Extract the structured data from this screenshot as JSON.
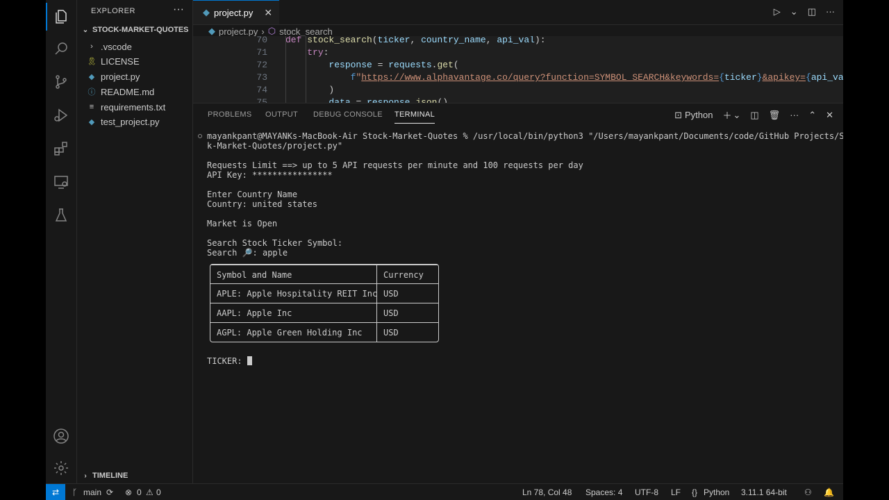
{
  "sidebar": {
    "title": "EXPLORER",
    "project": "STOCK-MARKET-QUOTES",
    "items": [
      {
        "label": ".vscode",
        "icon": "chevron-right-icon"
      },
      {
        "label": "LICENSE",
        "icon": "license-icon"
      },
      {
        "label": "project.py",
        "icon": "python-file-icon"
      },
      {
        "label": "README.md",
        "icon": "info-icon"
      },
      {
        "label": "requirements.txt",
        "icon": "text-file-icon"
      },
      {
        "label": "test_project.py",
        "icon": "python-file-icon"
      }
    ],
    "timeline": "TIMELINE"
  },
  "editor": {
    "tab": "project.py",
    "breadcrumb": {
      "file": "project.py",
      "symbol": "stock_search"
    },
    "lines": [
      {
        "num": "70",
        "parts": [
          [
            "kw",
            "def "
          ],
          [
            "fn",
            "stock_search"
          ],
          [
            "plain",
            "("
          ],
          [
            "var",
            "ticker"
          ],
          [
            "plain",
            ", "
          ],
          [
            "var",
            "country_name"
          ],
          [
            "plain",
            ", "
          ],
          [
            "var",
            "api_val"
          ],
          [
            "plain",
            "):"
          ]
        ]
      },
      {
        "num": "71",
        "parts": [
          [
            "plain",
            "    "
          ],
          [
            "kw",
            "try"
          ],
          [
            "plain",
            ":"
          ]
        ]
      },
      {
        "num": "72",
        "parts": [
          [
            "plain",
            "        "
          ],
          [
            "var",
            "response"
          ],
          [
            "plain",
            " = "
          ],
          [
            "var",
            "requests"
          ],
          [
            "plain",
            "."
          ],
          [
            "fn",
            "get"
          ],
          [
            "plain",
            "("
          ]
        ]
      },
      {
        "num": "73",
        "parts": [
          [
            "plain",
            "            "
          ],
          [
            "brace",
            "f"
          ],
          [
            "str",
            "\""
          ],
          [
            "url",
            "https://www.alphavantage.co/query?function=SYMBOL_SEARCH&keywords="
          ],
          [
            "brace",
            "{"
          ],
          [
            "var",
            "ticker"
          ],
          [
            "brace",
            "}"
          ],
          [
            "url",
            "&apikey="
          ],
          [
            "brace",
            "{"
          ],
          [
            "var",
            "api_val"
          ],
          [
            "brace",
            "}"
          ],
          [
            "str",
            "\""
          ]
        ]
      },
      {
        "num": "74",
        "parts": [
          [
            "plain",
            "        )"
          ]
        ]
      },
      {
        "num": "75",
        "parts": [
          [
            "plain",
            "        "
          ],
          [
            "var",
            "data"
          ],
          [
            "plain",
            " = "
          ],
          [
            "var",
            "response"
          ],
          [
            "plain",
            "."
          ],
          [
            "fn",
            "json"
          ],
          [
            "plain",
            "()"
          ]
        ]
      }
    ]
  },
  "panel": {
    "tabs": [
      "PROBLEMS",
      "OUTPUT",
      "DEBUG CONSOLE",
      "TERMINAL"
    ],
    "active_tab": "TERMINAL",
    "shell": "Python",
    "terminal_lines": [
      "mayankpant@MAYANKs-MacBook-Air Stock-Market-Quotes % /usr/local/bin/python3 \"/Users/mayankpant/Documents/code/GitHub Projects/Stoc",
      "k-Market-Quotes/project.py\"",
      "",
      "Requests Limit ==> up to 5 API requests per minute and 100 requests per day",
      "API Key: ****************",
      "",
      "Enter Country Name",
      "Country: united states",
      "",
      "Market is Open",
      "",
      "Search Stock Ticker Symbol:",
      "Search 🔎: apple"
    ],
    "table": {
      "headers": [
        "Symbol and Name",
        "Currency"
      ],
      "rows": [
        [
          "APLE: Apple Hospitality REIT Inc",
          "USD"
        ],
        [
          "AAPL: Apple Inc",
          "USD"
        ],
        [
          "AGPL: Apple Green Holding Inc",
          "USD"
        ]
      ]
    },
    "input_prompt": "TICKER: "
  },
  "status": {
    "branch": "main",
    "errors": "0",
    "warnings": "0",
    "position": "Ln 78, Col 48",
    "spaces": "Spaces: 4",
    "encoding": "UTF-8",
    "eol": "LF",
    "language": "Python",
    "interpreter": "3.11.1 64-bit"
  },
  "colors": {
    "accent": "#0078d4",
    "background": "#181818",
    "editor_bg": "#1f1f1f"
  }
}
